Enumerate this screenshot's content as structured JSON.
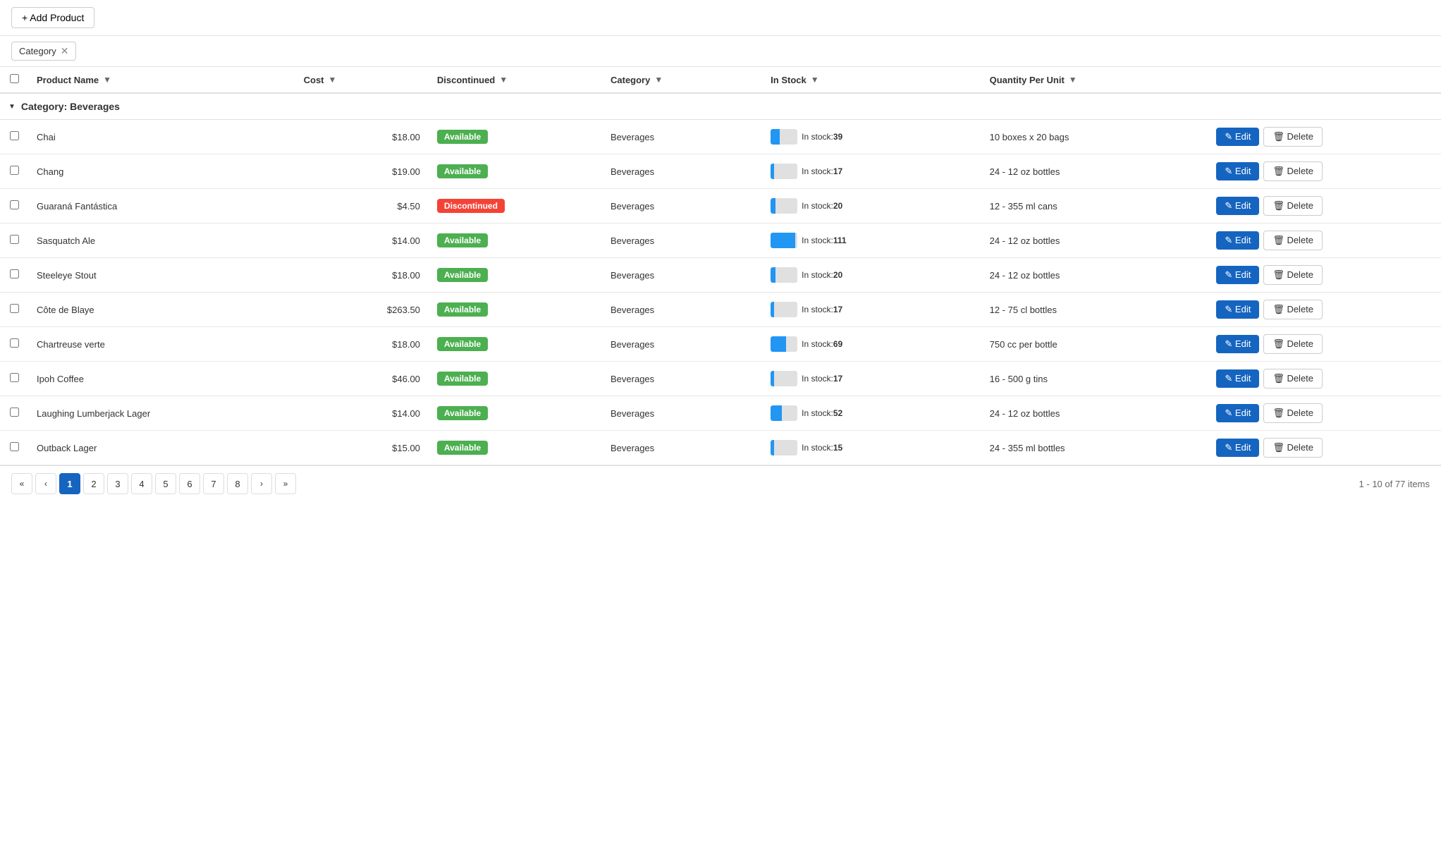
{
  "toolbar": {
    "add_button_label": "+ Add Product"
  },
  "filter_bar": {
    "filter_chip_label": "Category",
    "filter_chip_close": "✕"
  },
  "table": {
    "columns": [
      {
        "id": "name",
        "label": "Product Name",
        "filterable": true
      },
      {
        "id": "cost",
        "label": "Cost",
        "filterable": true
      },
      {
        "id": "discontinued",
        "label": "Discontinued",
        "filterable": true
      },
      {
        "id": "category",
        "label": "Category",
        "filterable": true
      },
      {
        "id": "stock",
        "label": "In Stock",
        "filterable": true
      },
      {
        "id": "qpu",
        "label": "Quantity Per Unit",
        "filterable": true
      }
    ],
    "group": {
      "label": "Category: Beverages"
    },
    "rows": [
      {
        "name": "Chai",
        "cost": "$18.00",
        "discontinued": false,
        "category": "Beverages",
        "stock": 39,
        "stock_max": 120,
        "qpu": "10 boxes x 20 bags"
      },
      {
        "name": "Chang",
        "cost": "$19.00",
        "discontinued": false,
        "category": "Beverages",
        "stock": 17,
        "stock_max": 120,
        "qpu": "24 - 12 oz bottles"
      },
      {
        "name": "Guaraná Fantástica",
        "cost": "$4.50",
        "discontinued": true,
        "category": "Beverages",
        "stock": 20,
        "stock_max": 120,
        "qpu": "12 - 355 ml cans"
      },
      {
        "name": "Sasquatch Ale",
        "cost": "$14.00",
        "discontinued": false,
        "category": "Beverages",
        "stock": 111,
        "stock_max": 120,
        "qpu": "24 - 12 oz bottles"
      },
      {
        "name": "Steeleye Stout",
        "cost": "$18.00",
        "discontinued": false,
        "category": "Beverages",
        "stock": 20,
        "stock_max": 120,
        "qpu": "24 - 12 oz bottles"
      },
      {
        "name": "Côte de Blaye",
        "cost": "$263.50",
        "discontinued": false,
        "category": "Beverages",
        "stock": 17,
        "stock_max": 120,
        "qpu": "12 - 75 cl bottles"
      },
      {
        "name": "Chartreuse verte",
        "cost": "$18.00",
        "discontinued": false,
        "category": "Beverages",
        "stock": 69,
        "stock_max": 120,
        "qpu": "750 cc per bottle"
      },
      {
        "name": "Ipoh Coffee",
        "cost": "$46.00",
        "discontinued": false,
        "category": "Beverages",
        "stock": 17,
        "stock_max": 120,
        "qpu": "16 - 500 g tins"
      },
      {
        "name": "Laughing Lumberjack Lager",
        "cost": "$14.00",
        "discontinued": false,
        "category": "Beverages",
        "stock": 52,
        "stock_max": 120,
        "qpu": "24 - 12 oz bottles"
      },
      {
        "name": "Outback Lager",
        "cost": "$15.00",
        "discontinued": false,
        "category": "Beverages",
        "stock": 15,
        "stock_max": 120,
        "qpu": "24 - 355 ml bottles"
      }
    ],
    "edit_label": "✏ Edit",
    "delete_label": "🗑 Delete",
    "available_label": "Available",
    "discontinued_label": "Discontinued"
  },
  "pagination": {
    "pages": [
      1,
      2,
      3,
      4,
      5,
      6,
      7,
      8
    ],
    "current_page": 1,
    "info": "1 - 10 of 77 items",
    "first_label": "«",
    "prev_label": "‹",
    "next_label": "›",
    "last_label": "»"
  }
}
